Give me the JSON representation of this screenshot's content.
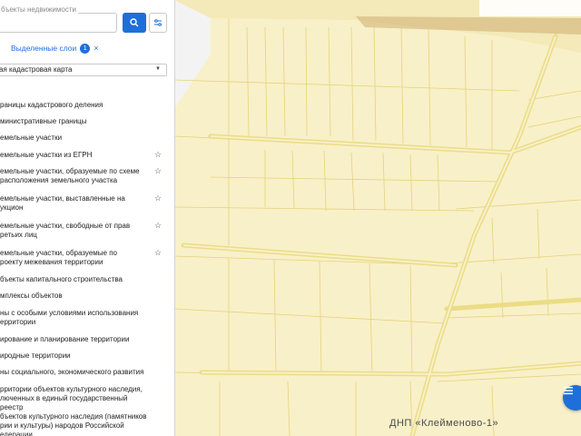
{
  "search": {
    "placeholder": "бъекты недвижимости"
  },
  "layers_selected": {
    "label": "Выделенные слои",
    "count": "1",
    "close_glyph": "×"
  },
  "map_select": {
    "value": "ая кадастровая карта",
    "caret": "▼"
  },
  "layers": [
    {
      "label": "раницы кадастрового деления",
      "star": false
    },
    {
      "label": "министративные границы",
      "star": false
    },
    {
      "label": "емельные участки",
      "star": false
    },
    {
      "label": "емельные участки из ЕГРН",
      "star": true
    },
    {
      "label": "емельные участки, образуемые по схеме\nрасположения земельного участка",
      "star": true
    },
    {
      "label": "емельные участки, выставленные на\nукцион",
      "star": true
    },
    {
      "label": "емельные участки, свободные от прав\nретьих лиц",
      "star": true
    },
    {
      "label": "емельные участки, образуемые по\nроекту межевания территории",
      "star": true
    },
    {
      "label": "бъекты капитального строительства",
      "star": false
    },
    {
      "label": "мплексы объектов",
      "star": false
    },
    {
      "label": "ны с особыми условиями использования\nерритории",
      "star": false
    },
    {
      "label": "ирование и планирование территории",
      "star": false
    },
    {
      "label": "иродные территории",
      "star": false
    },
    {
      "label": "ны социального, экономического развития",
      "star": false
    },
    {
      "label": "рритории объектов культурного наследия,\nлюченных в единый государственный реестр\nбъектов культурного наследия (памятников\nрии и культуры) народов Российской\nедерации",
      "star": false
    }
  ],
  "star_glyph": "☆",
  "map": {
    "label": "ДНП «Клейменово-1»"
  },
  "colors": {
    "accent": "#1e6fd9",
    "parcel_fill": "#f8f0c8",
    "parcel_line": "#e2d27a",
    "road": "#efe39a"
  }
}
